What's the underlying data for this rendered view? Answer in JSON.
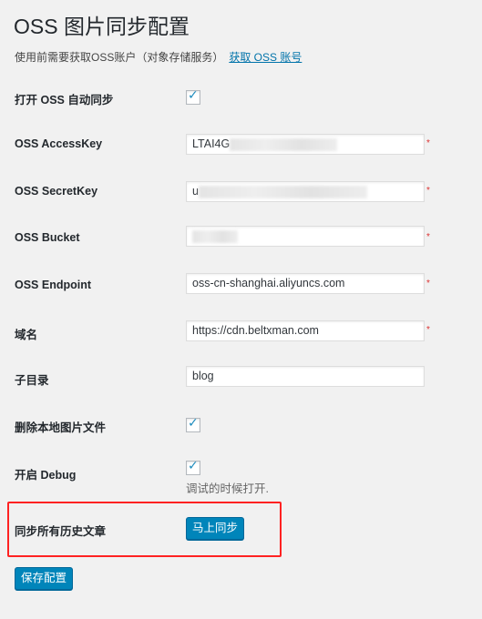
{
  "title": "OSS 图片同步配置",
  "intro": {
    "text": "使用前需要获取OSS账户（对象存储服务）",
    "link": "获取 OSS 账号"
  },
  "fields": {
    "auto_sync": {
      "label": "打开 OSS 自动同步",
      "checked": true
    },
    "access_key": {
      "label": "OSS AccessKey",
      "value": "LTAI4G",
      "required": "*"
    },
    "secret_key": {
      "label": "OSS SecretKey",
      "value": "u",
      "required": "*"
    },
    "bucket": {
      "label": "OSS Bucket",
      "value": "",
      "required": "*"
    },
    "endpoint": {
      "label": "OSS Endpoint",
      "value": "oss-cn-shanghai.aliyuncs.com",
      "required": "*"
    },
    "domain": {
      "label": "域名",
      "value": "https://cdn.beltxman.com",
      "required": "*"
    },
    "subdir": {
      "label": "子目录",
      "value": "blog"
    },
    "delete_local": {
      "label": "删除本地图片文件",
      "checked": true
    },
    "debug": {
      "label": "开启 Debug",
      "checked": true,
      "description": "调试的时候打开."
    },
    "sync_history": {
      "label": "同步所有历史文章",
      "button": "马上同步"
    }
  },
  "save_button": "保存配置",
  "colors": {
    "primary": "#0085ba",
    "link": "#0073aa",
    "required": "#dc3232",
    "highlight": "#ff2222"
  }
}
